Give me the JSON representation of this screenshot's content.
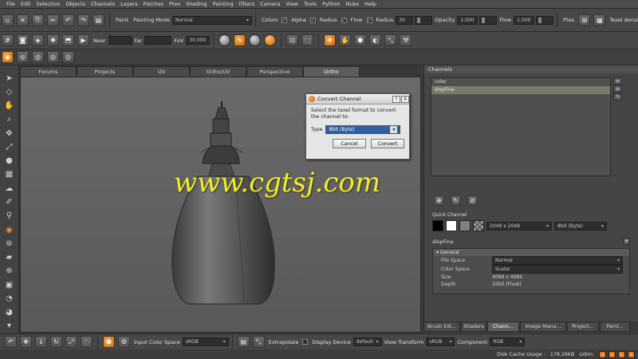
{
  "menubar": [
    "File",
    "Edit",
    "Selection",
    "Objects",
    "Channels",
    "Layers",
    "Patches",
    "Ptex",
    "Shading",
    "Painting",
    "Filters",
    "Camera",
    "View",
    "Tools",
    "Python",
    "Nuke",
    "Help"
  ],
  "paint_toolbar": {
    "paint_label": "Paint",
    "painting_mode_label": "Painting Mode",
    "painting_mode_value": "Normal",
    "colors_label": "Colors",
    "alpha_label": "Alpha",
    "radius_label": "Radius",
    "flow_label": "Flow",
    "radius2_label": "Radius",
    "radius_value": "30",
    "opacity_label": "Opacity",
    "opacity_value": "1.000",
    "flow2_label": "Flow",
    "flow_value": "1.000",
    "ptex_label": "Ptex",
    "texel_density_label": "Texel density"
  },
  "camera_toolbar": {
    "near_label": "Near",
    "far_label": "Far",
    "fov_label": "FoV",
    "fov_value": "30.000"
  },
  "view_tabs": [
    "Forums",
    "Projects",
    "UV",
    "Ortho/UV",
    "Perspective",
    "Ortho"
  ],
  "active_view_tab": "Ortho",
  "watermark": "www.cgtsj.com",
  "dialog": {
    "title": "Convert Channel",
    "help_btn": "?",
    "close_btn": "X",
    "message": "Select the texel format to convert the channel to:",
    "type_label": "Type",
    "type_value": "8bit (Byte)",
    "cancel_label": "Cancel",
    "convert_label": "Convert"
  },
  "channels_panel": {
    "title": "Channels",
    "items": [
      "color",
      "dispFine"
    ],
    "selected": "dispFine",
    "quick_channel_label": "Quick Channel",
    "size_value": "2048 x 2048",
    "depth_value": "8bit (Byte)",
    "selected_channel": "dispFine",
    "general_label": "General",
    "file_space_label": "File Space",
    "file_space_value": "Normal",
    "color_space_label": "Color Space",
    "color_space_value": "Scalar",
    "size_label": "Size",
    "size_info": "4096 x 4096",
    "depth_label": "Depth",
    "depth_info": "32bit (Float)"
  },
  "right_tabs": [
    "Brush Edi...",
    "Shaders",
    "Chann...",
    "Image Mana...",
    "Project...",
    "Paint..."
  ],
  "active_right_tab": "Chann...",
  "bottom_toolbar": {
    "input_color_space_label": "Input Color Space",
    "input_color_space_value": "sRGB",
    "extrapolate_label": "Extrapolate",
    "display_device_label": "Display Device",
    "display_device_value": "default",
    "view_transform_label": "View Transform",
    "view_transform_value": "sRGB",
    "component_label": "Component",
    "component_value": "RGB"
  },
  "status": {
    "disk_cache_label": "Disk Cache Usage :",
    "disk_cache_value": "178.26KB",
    "undo_label": "Udim:"
  },
  "colors": {
    "accent": "#f08a2a",
    "selection": "#2f5fa0",
    "watermark": "#f2ee25"
  }
}
